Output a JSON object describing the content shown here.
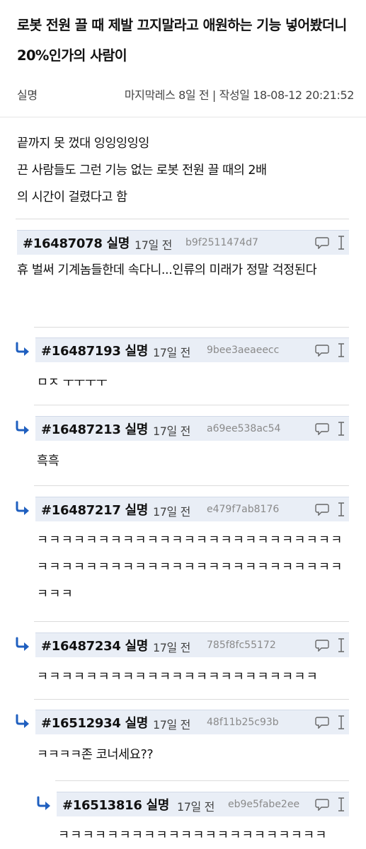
{
  "post": {
    "title": "로봇 전원 끌 때 제발 끄지말라고 애원하는 기능 넣어봤더니 20%인가의 사람이",
    "author": "실명",
    "meta_right": "마지막레스 8일 전 | 작성일 18-08-12 20:21:52",
    "body": "끝까지 못 껐대 잉잉잉잉잉\n끈 사람들도 그런 기능 없는 로봇 전원 끌 때의 2배\n의 시간이 걸렸다고 함"
  },
  "comments": [
    {
      "number": "#16487078",
      "author": "실명",
      "time": "17일 전",
      "hash": "b9f2511474d7",
      "text": "휴 벌써 기계놈들한데 속다니...인류의 미래가 정말 걱정된다",
      "depth": 0
    },
    {
      "number": "#16487193",
      "author": "실명",
      "time": "17일 전",
      "hash": "9bee3aeaeecc",
      "text": "ㅁㅈ ㅜㅜㅜㅜ",
      "depth": 1
    },
    {
      "number": "#16487213",
      "author": "실명",
      "time": "17일 전",
      "hash": "a69ee538ac54",
      "text": "흑흑",
      "depth": 1
    },
    {
      "number": "#16487217",
      "author": "실명",
      "time": "17일 전",
      "hash": "e479f7ab8176",
      "text": "ㅋㅋㅋㅋㅋㅋㅋㅋㅋㅋㅋㅋㅋㅋㅋㅋㅋㅋㅋㅋㅋㅋㅋㅋㅋㅋㅋㅋㅋㅋㅋㅋㅋㅋㅋㅋㅋㅋㅋㅋㅋㅋㅋㅋㅋㅋㅋㅋㅋㅋㅋㅋㅋ",
      "depth": 1
    },
    {
      "number": "#16487234",
      "author": "실명",
      "time": "17일 전",
      "hash": "785f8fc55172",
      "text": "ㅋㅋㅋㅋㅋㅋㅋㅋㅋㅋㅋㅋㅋㅋㅋㅋㅋㅋㅋㅋㅋㅋㅋ",
      "depth": 1
    },
    {
      "number": "#16512934",
      "author": "실명",
      "time": "17일 전",
      "hash": "48f11b25c93b",
      "text": "ㅋㅋㅋㅋ존 코너세요??",
      "depth": 1
    },
    {
      "number": "#16513816",
      "author": "실명",
      "time": "17일 전",
      "hash": "eb9e5fabe2ee",
      "text": "ㅋㅋㅋㅋㅋㅋㅋㅋㅋㅋㅋㅋㅋㅋㅋㅋㅋㅋㅋㅋㅋㅋ",
      "depth": 2
    }
  ],
  "icons": {
    "reply": "reply-arrow-icon",
    "comment": "speech-bubble-icon",
    "cursor": "text-cursor-icon"
  },
  "colors": {
    "header_bg": "#e9eef6",
    "reply_arrow": "#1f5fbf",
    "hash_text": "#8a8a8a"
  }
}
